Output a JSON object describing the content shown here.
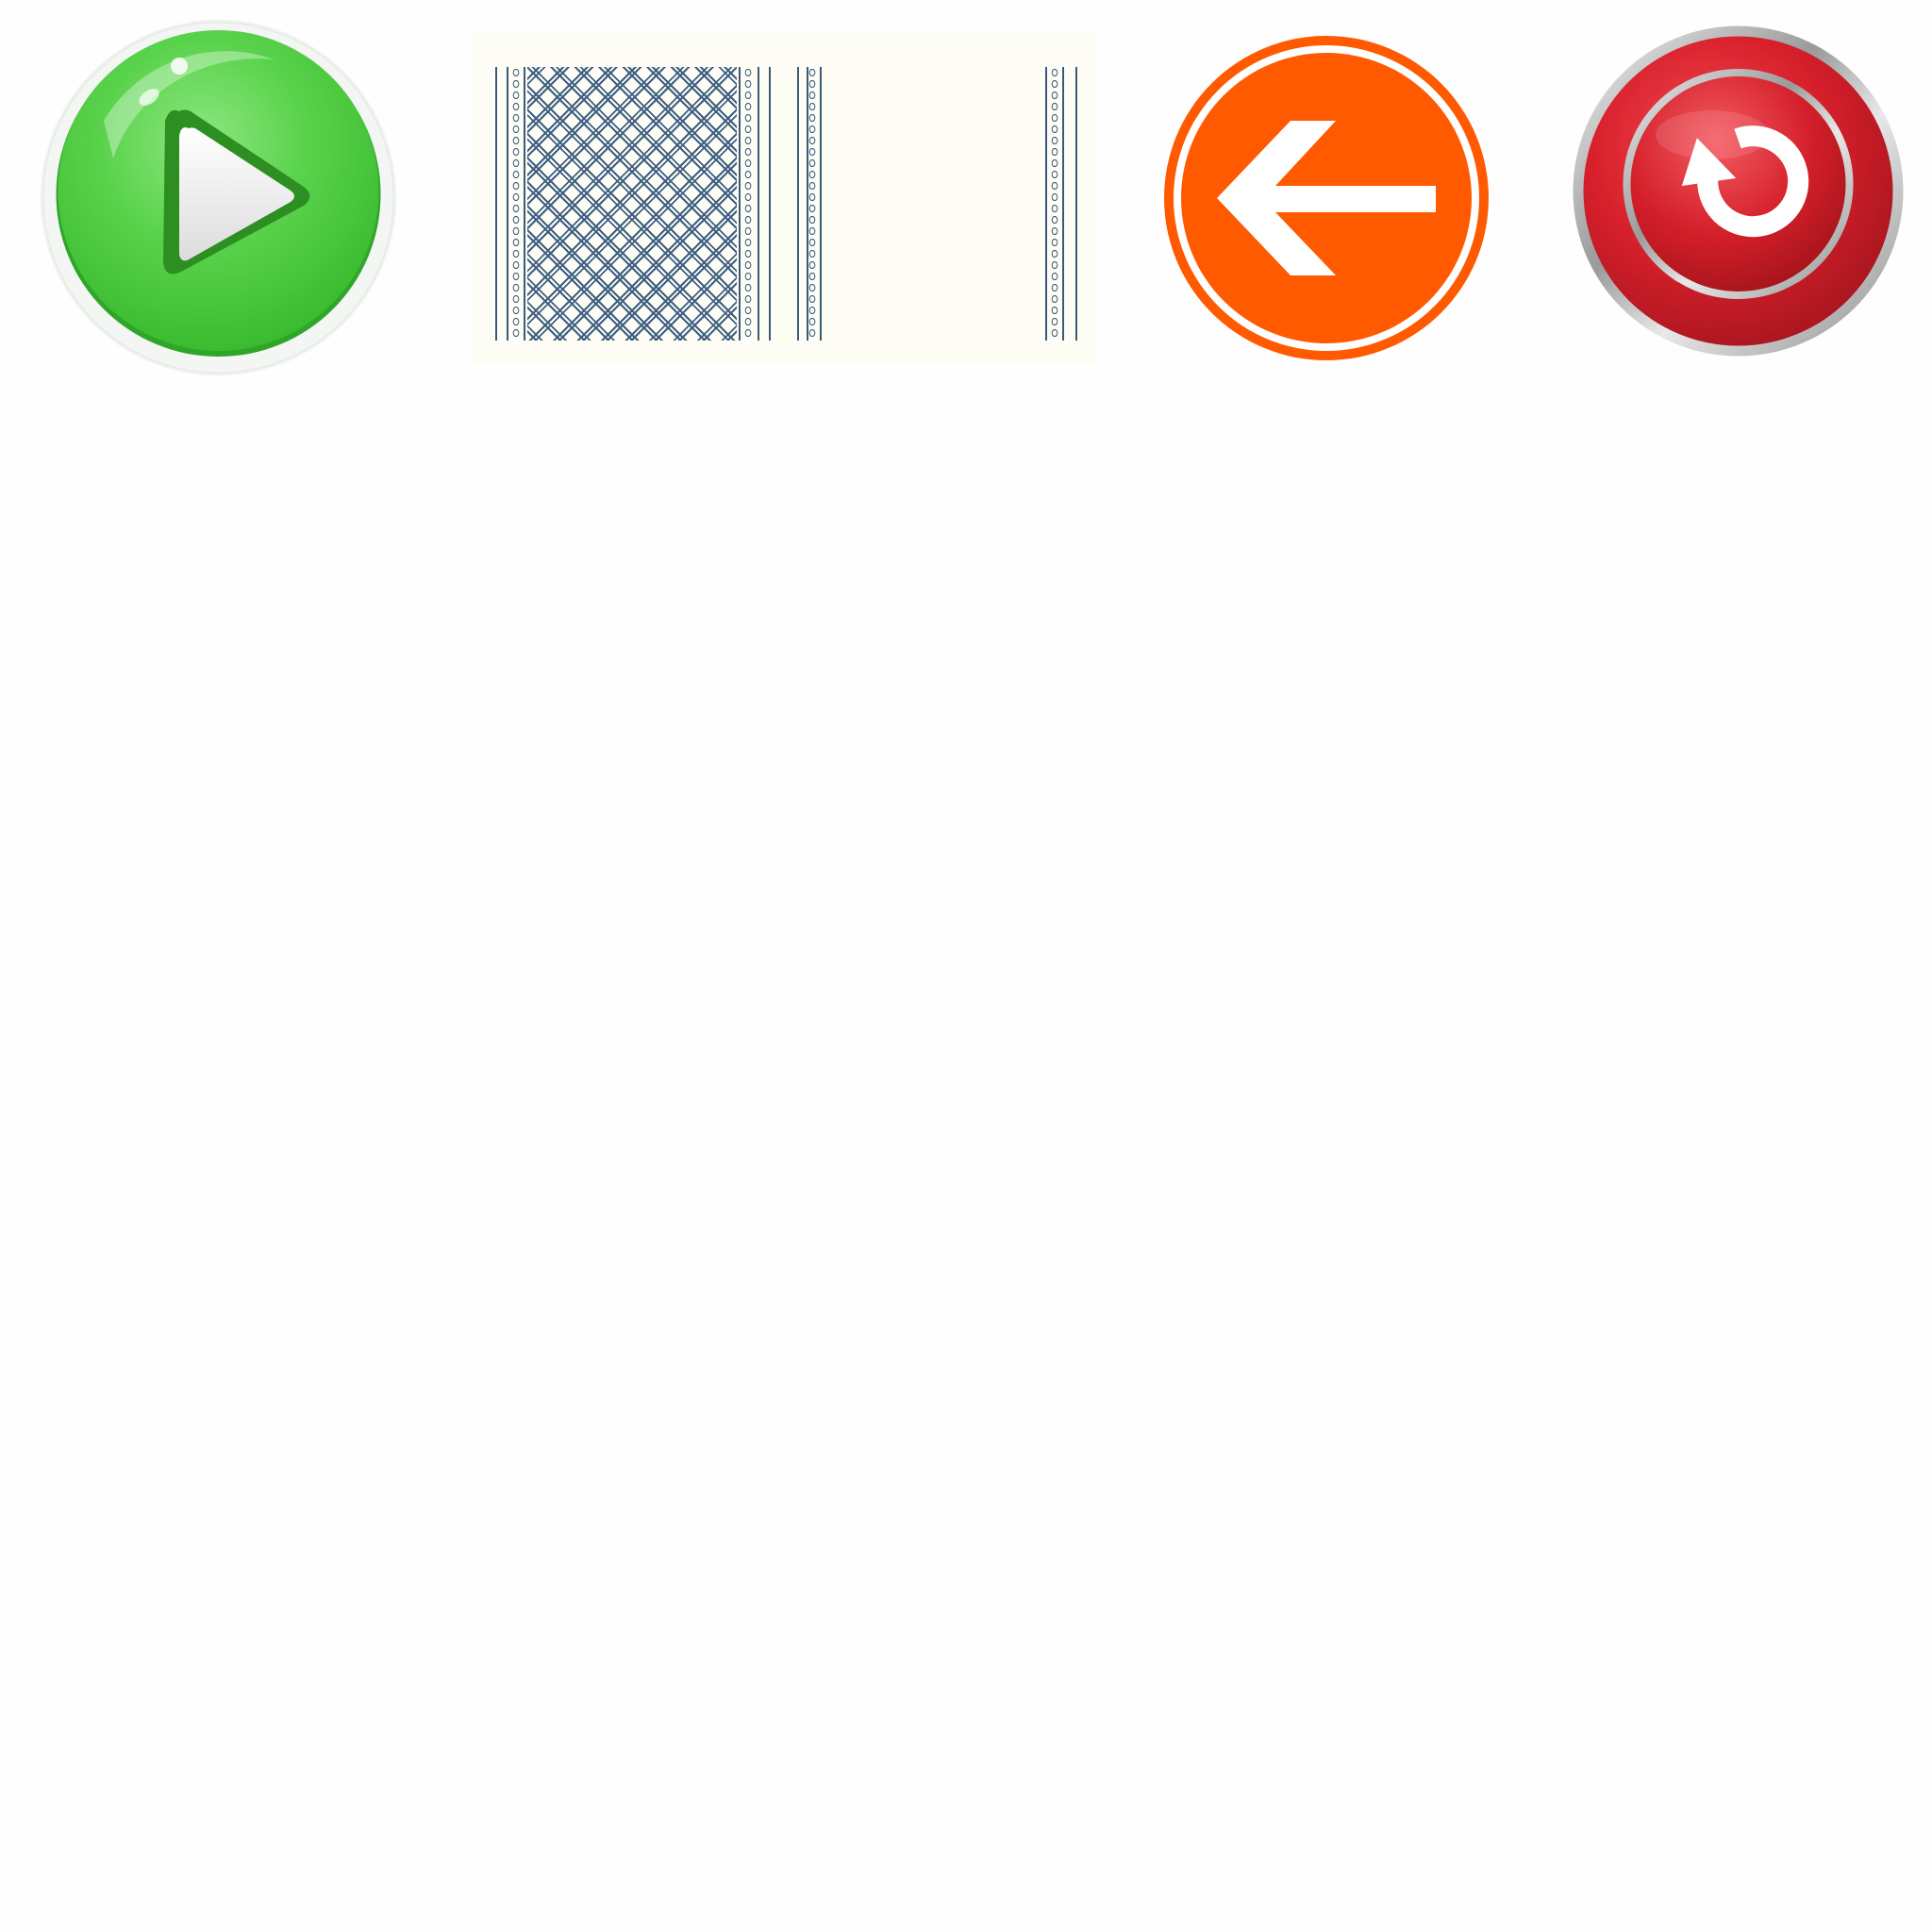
{
  "toolbar": {
    "buttons": [
      {
        "id": "play",
        "icon": "play-icon",
        "color": "#4cc940",
        "accent": "#2a9a24"
      },
      {
        "id": "pattern-panel",
        "icon": "lattice-pattern",
        "color": "#3f5f80",
        "background": "#fdfdf6"
      },
      {
        "id": "back",
        "icon": "arrow-left-icon",
        "color": "#ff5a00"
      },
      {
        "id": "reset",
        "icon": "reset-icon",
        "color": "#d8202c",
        "ring": "#c8c8c8"
      }
    ]
  },
  "page": {
    "background": "#fefefe"
  }
}
